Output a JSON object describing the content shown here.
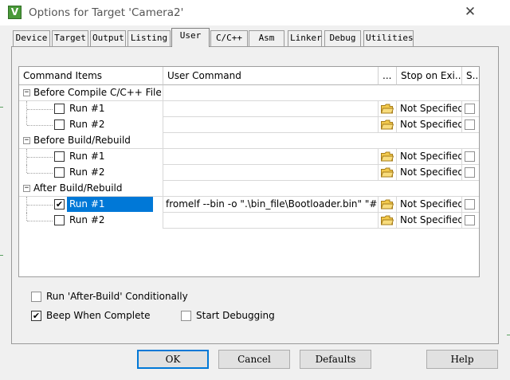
{
  "window": {
    "icon_glyph": "V",
    "title": "Options for Target 'Camera2'",
    "close_glyph": "✕"
  },
  "tabs": [
    "Device",
    "Target",
    "Output",
    "Listing",
    "User",
    "C/C++",
    "Asm",
    "Linker",
    "Debug",
    "Utilities"
  ],
  "active_tab": "User",
  "grid": {
    "headers": {
      "command_items": "Command Items",
      "user_command": "User Command",
      "browse": "...",
      "stop_on_exit": "Stop on Exi...",
      "s": "S..."
    },
    "groups": [
      {
        "label": "Before Compile C/C++ File",
        "runs": [
          {
            "label": "Run #1",
            "checked": false,
            "command": "",
            "stop": "Not Specified"
          },
          {
            "label": "Run #2",
            "checked": false,
            "command": "",
            "stop": "Not Specified"
          }
        ]
      },
      {
        "label": "Before Build/Rebuild",
        "runs": [
          {
            "label": "Run #1",
            "checked": false,
            "command": "",
            "stop": "Not Specified"
          },
          {
            "label": "Run #2",
            "checked": false,
            "command": "",
            "stop": "Not Specified"
          }
        ]
      },
      {
        "label": "After Build/Rebuild",
        "runs": [
          {
            "label": "Run #1",
            "checked": true,
            "command": "fromelf --bin -o \".\\bin_file\\Bootloader.bin\" \"#L\"",
            "stop": "Not Specified"
          },
          {
            "label": "Run #2",
            "checked": false,
            "command": "",
            "stop": "Not Specified"
          }
        ]
      }
    ]
  },
  "options": {
    "run_after_build_label": "Run 'After-Build' Conditionally",
    "run_after_build_checked": false,
    "beep_label": "Beep When Complete",
    "beep_checked": true,
    "start_debug_label": "Start Debugging",
    "start_debug_checked": false
  },
  "buttons": {
    "ok": "OK",
    "cancel": "Cancel",
    "defaults": "Defaults",
    "help": "Help"
  },
  "colors": {
    "selection": "#0078d7",
    "dialog_bg": "#f0f0f0"
  },
  "icons": {
    "expander": "minus-box-icon",
    "browse": "folder-open-icon"
  }
}
